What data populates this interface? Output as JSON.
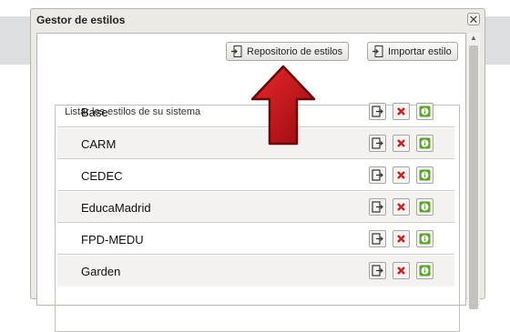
{
  "dialog": {
    "title": "Gestor de estilos",
    "close_glyph": "✕"
  },
  "toolbar": {
    "repository_label": "Repositorio de estilos",
    "import_label": "Importar estilo",
    "repository_icon": "import-icon",
    "import_icon": "import-icon"
  },
  "styles_section": {
    "legend": "Listar los estilos de su sistema",
    "styles": [
      {
        "name": "Base"
      },
      {
        "name": "CARM"
      },
      {
        "name": "CEDEC"
      },
      {
        "name": "EducaMadrid"
      },
      {
        "name": "FPD-MEDU"
      },
      {
        "name": "Garden"
      }
    ],
    "actions": [
      "export-icon",
      "delete-icon",
      "info-icon"
    ]
  },
  "colors": {
    "arrow_fill": "#c81218",
    "delete_red": "#cc1f1f",
    "info_green": "#5aa629"
  }
}
